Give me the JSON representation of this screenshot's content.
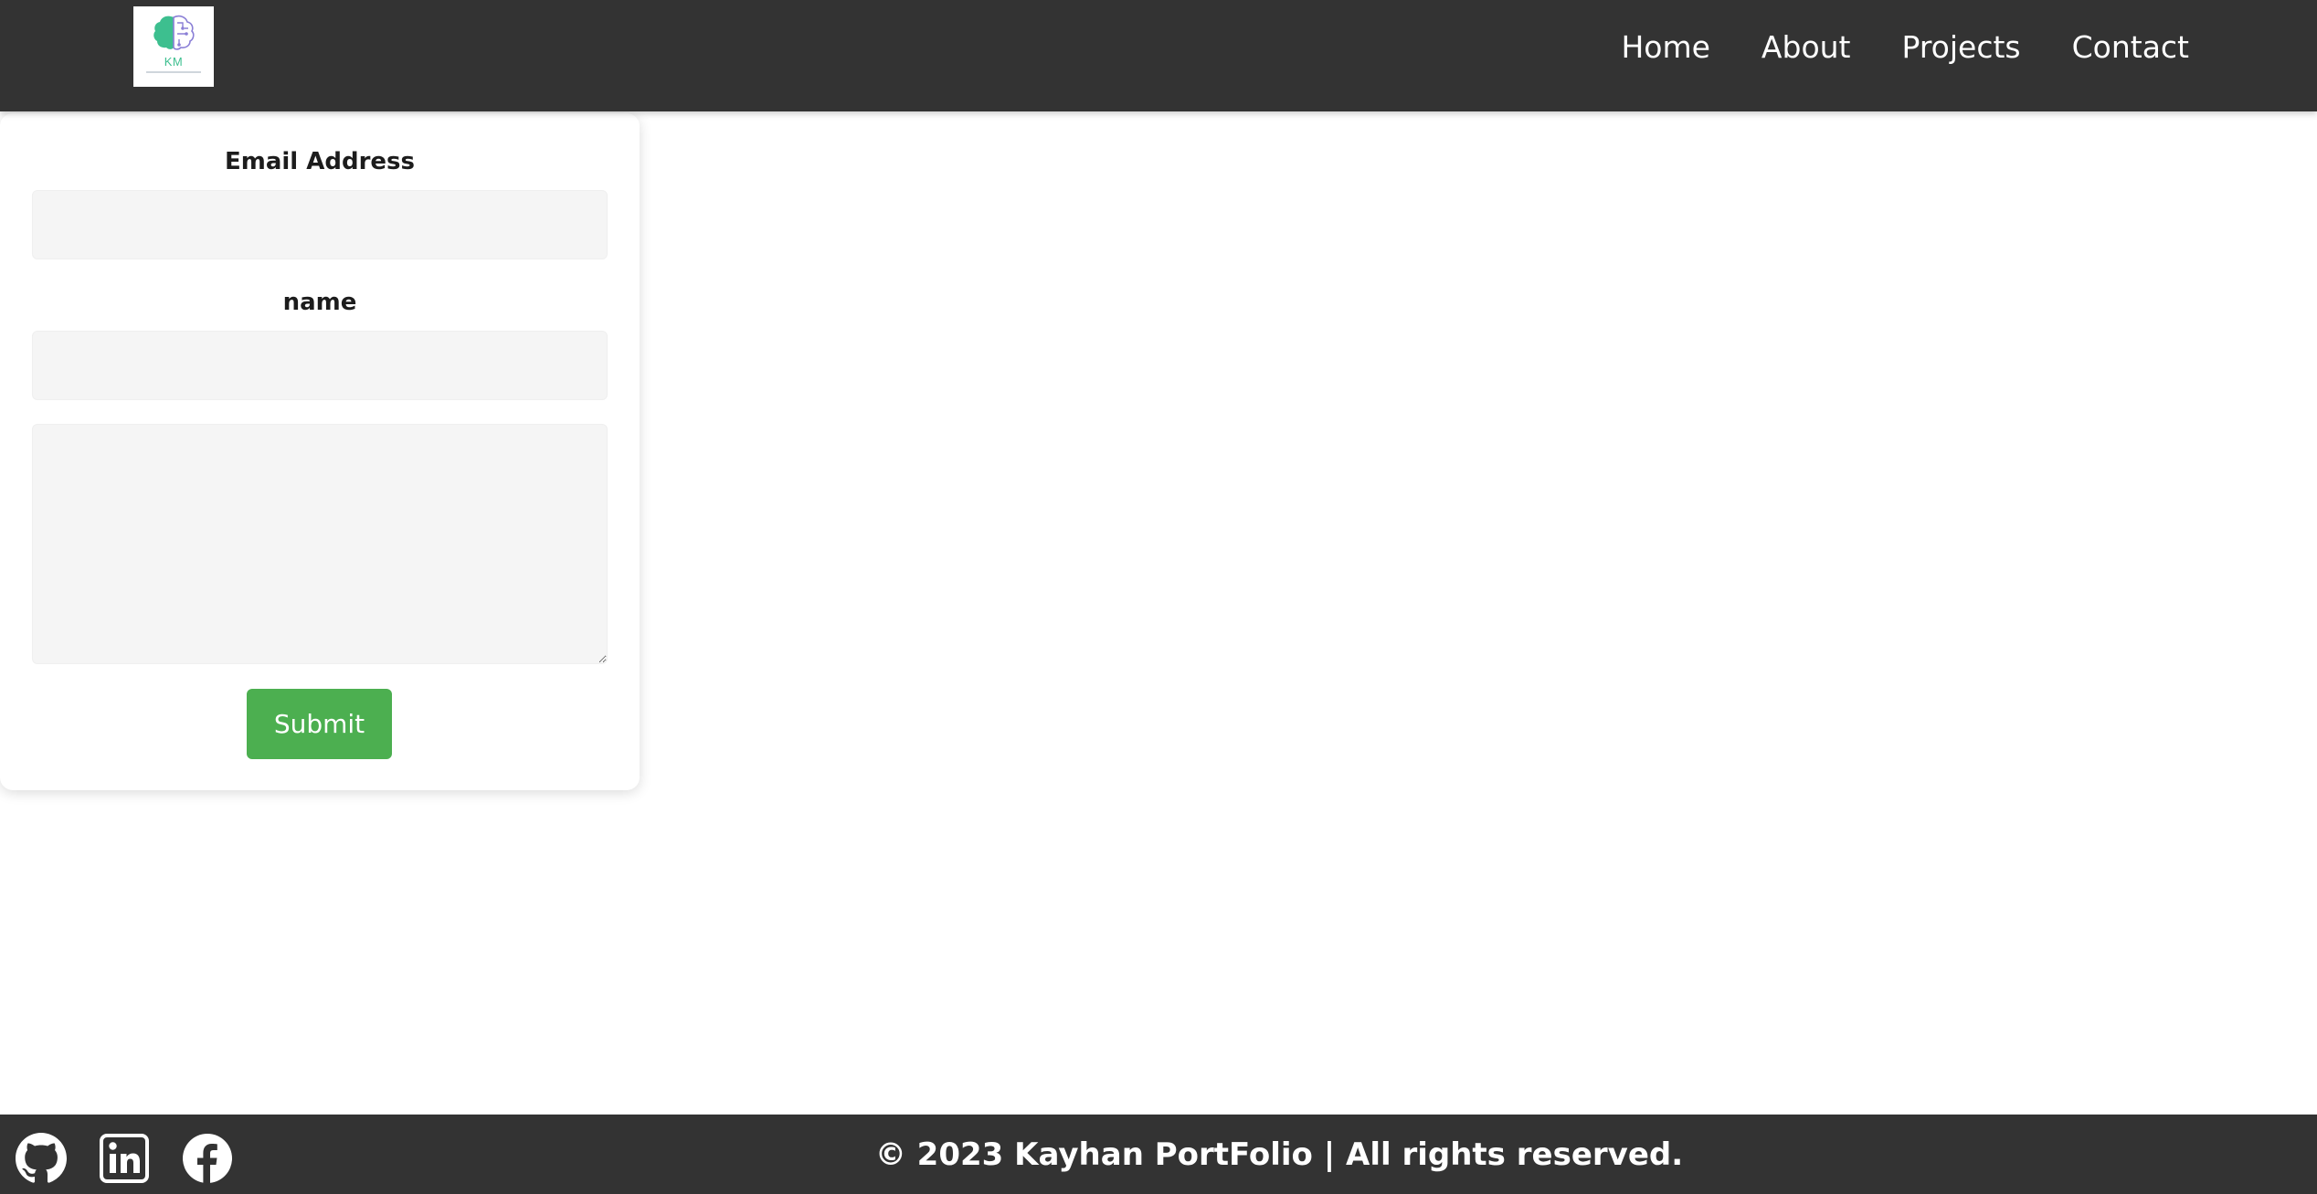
{
  "header": {
    "logo_initials": "KM",
    "nav": [
      {
        "label": "Home"
      },
      {
        "label": "About"
      },
      {
        "label": "Projects"
      },
      {
        "label": "Contact"
      }
    ]
  },
  "form": {
    "email_label": "Email Address",
    "email_value": "",
    "name_label": "name",
    "name_value": "",
    "message_value": "",
    "submit_label": "Submit"
  },
  "footer": {
    "copyright": "© 2023 Kayhan PortFolio | All rights reserved.",
    "social_icons": [
      "github-icon",
      "linkedin-icon",
      "facebook-icon"
    ]
  },
  "colors": {
    "bar_background": "#333333",
    "page_background": "#ffffff",
    "field_background": "#f5f5f5",
    "submit_button": "#4caf50",
    "logo_green": "#3dbf8f",
    "logo_purple": "#8a7fd6"
  }
}
